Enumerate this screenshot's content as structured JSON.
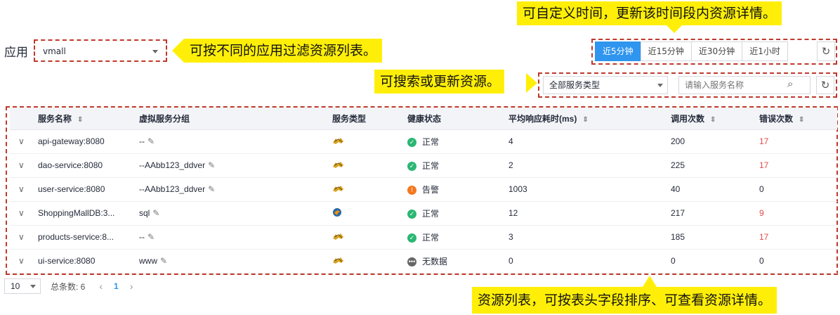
{
  "app": {
    "label": "应用",
    "selected": "vmall"
  },
  "annotations": {
    "app_filter": "可按不同的应用过滤资源列表。",
    "time_range": "可自定义时间，更新该时间段内资源详情。",
    "search": "可搜索或更新资源。",
    "table": "资源列表，可按表头字段排序、可查看资源详情。"
  },
  "time_range": {
    "options": [
      "近5分钟",
      "近15分钟",
      "近30分钟",
      "近1小时"
    ],
    "active_index": 0
  },
  "filter": {
    "service_type": "全部服务类型",
    "search_placeholder": "请输入服务名称"
  },
  "table": {
    "columns": [
      "服务名称",
      "虚拟服务分组",
      "服务类型",
      "健康状态",
      "平均响应耗时(ms)",
      "调用次数",
      "错误次数"
    ],
    "rows": [
      {
        "name": "api-gateway:8080",
        "group": "--",
        "type_icon": "tomcat-icon",
        "health": "正常",
        "health_kind": "normal",
        "latency": "4",
        "calls": "200",
        "errors": "17"
      },
      {
        "name": "dao-service:8080",
        "group": "--AAbb123_ddver",
        "type_icon": "tomcat-icon",
        "health": "正常",
        "health_kind": "normal",
        "latency": "2",
        "calls": "225",
        "errors": "17"
      },
      {
        "name": "user-service:8080",
        "group": "--AAbb123_ddver",
        "type_icon": "tomcat-icon",
        "health": "告警",
        "health_kind": "warning",
        "latency": "1003",
        "calls": "40",
        "errors": "0"
      },
      {
        "name": "ShoppingMallDB:3...",
        "group": "sql",
        "type_icon": "mysql-icon",
        "health": "正常",
        "health_kind": "normal",
        "latency": "12",
        "calls": "217",
        "errors": "9"
      },
      {
        "name": "products-service:8...",
        "group": "--",
        "type_icon": "tomcat-icon",
        "health": "正常",
        "health_kind": "normal",
        "latency": "3",
        "calls": "185",
        "errors": "17"
      },
      {
        "name": "ui-service:8080",
        "group": "www",
        "type_icon": "tomcat-icon",
        "health": "无数据",
        "health_kind": "nodata",
        "latency": "0",
        "calls": "0",
        "errors": "0"
      }
    ]
  },
  "pagination": {
    "page_size": "10",
    "total": "总条数: 6",
    "current_page": "1"
  },
  "colors": {
    "primary": "#2f95ef",
    "normal": "#2bb673",
    "warning": "#f37920",
    "nodata": "#666666",
    "error_text": "#e84a4a",
    "callout": "#ffef08",
    "dashed": "#c0392b"
  }
}
